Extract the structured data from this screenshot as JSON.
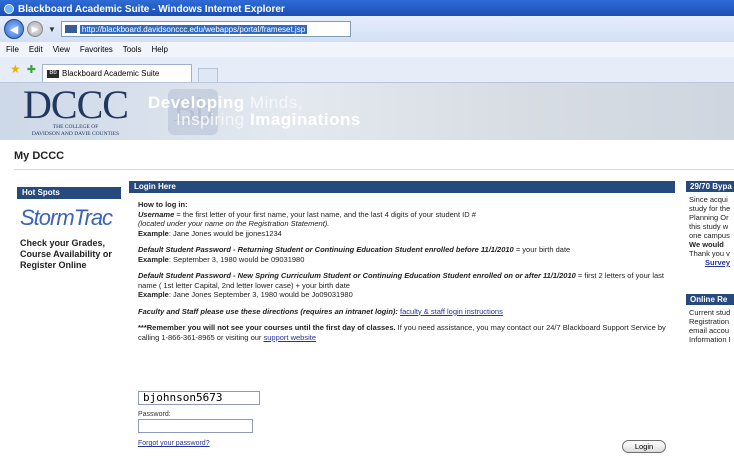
{
  "browser": {
    "title": "Blackboard Academic Suite - Windows Internet Explorer",
    "url": "http://blackboard.davidsonccc.edu/webapps/portal/frameset.jsp",
    "menu": [
      "File",
      "Edit",
      "View",
      "Favorites",
      "Tools",
      "Help"
    ],
    "tab_label": "Blackboard Academic Suite"
  },
  "banner": {
    "logo_big": "DCCC",
    "logo_line1": "THE COLLEGE OF",
    "logo_line2": "DAVIDSON AND DAVIE COUNTIES",
    "tag_line1_bold": "Developing",
    "tag_line1_lite": " Minds,",
    "tag_line2_lite": "Inspiring ",
    "tag_line2_bold": "Imaginations"
  },
  "page_title": "My DCCC",
  "hotspots": {
    "header": "Hot Spots",
    "logo_a": "Storm",
    "logo_b": "Trac",
    "text": "Check your Grades, Course Availability or Register Online"
  },
  "login": {
    "header": "Login Here",
    "how_title": "How to log in:",
    "username_label": "Username",
    "username_desc": " = the first letter of your first name, your last name, and the last 4 digits of your student ID #",
    "username_note": "(located under your name on the Registration Statement).",
    "example_label": "Example",
    "username_example": ": Jane Jones would be jjones1234",
    "default_pw1": "Default Student Password - Returning Student or Continuing Education Student enrolled before 11/1/2010",
    "default_pw1_rest": " = your birth date",
    "pw1_example": ": September 3, 1980 would be 09031980",
    "default_pw2": "Default Student Password - New Spring Curriculum Student or Continuing Education Student enrolled on or after 11/1/2010",
    "default_pw2_rest": " = first 2 letters of your last name ( 1st letter Capital, 2nd letter lower case) + your birth date",
    "pw2_example": ": Jane Jones September 3, 1980 would be Jo09031980",
    "faculty_text": "Faculty and Staff please use these directions (requires an intranet login): ",
    "faculty_link": "faculty & staff login instructions",
    "remember_bold": "***Remember you will not see your courses until the first day of classes.",
    "remember_rest": " If you need assistance, you may contact our 24/7 Blackboard Support Service by calling 1-866-361-8965 or visiting our ",
    "support_link": "support website",
    "username_value": "bjohnson5673",
    "password_label": "Password:",
    "password_value": "",
    "forgot_link": "Forgot your password?",
    "login_button": "Login"
  },
  "right": {
    "header1": "29/70 Bypa",
    "lines1": [
      "Since acqui",
      "study for the",
      "Planning Or",
      "this study w",
      "one campus"
    ],
    "bold_line": "We would",
    "thank_line": "Thank you v",
    "survey_link": "Survey",
    "header2": "Online Re",
    "lines2": [
      "Current stud",
      "Registration",
      "email accou",
      "Information I"
    ]
  }
}
